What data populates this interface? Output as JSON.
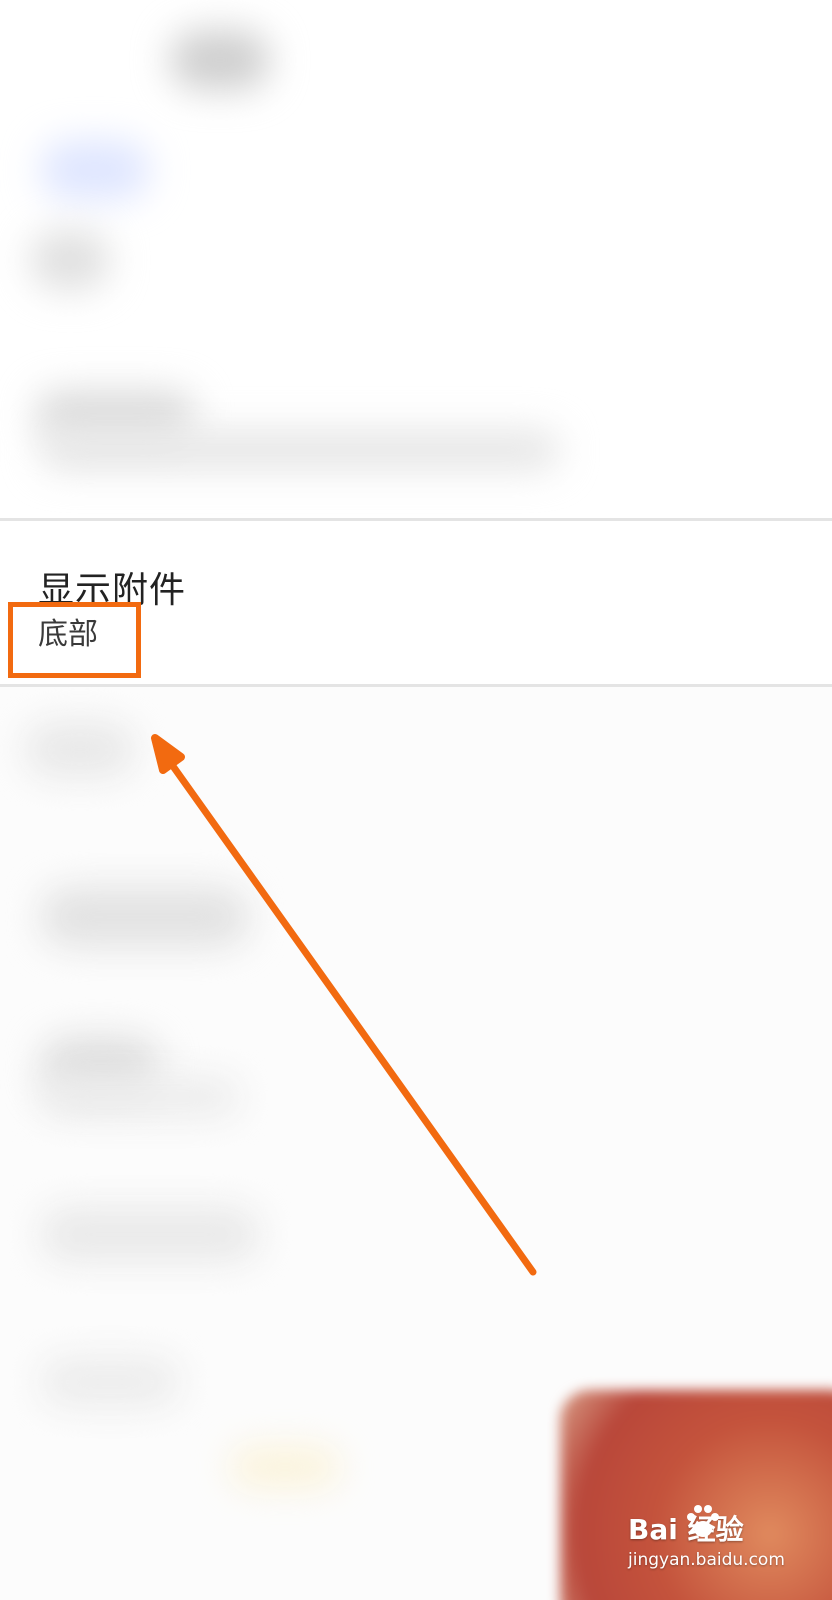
{
  "setting": {
    "title": "显示附件",
    "value": "底部"
  },
  "colors": {
    "accent": "#f26a10",
    "divider": "#e4e4e4",
    "title_text": "#222222",
    "value_text": "#3a3a3a"
  },
  "watermark": {
    "brand": "Bai  经验",
    "url": "jingyan.baidu.com",
    "icon": "paw-icon"
  },
  "annotations": {
    "highlight_target": "setting-value",
    "arrow_icon": "arrow-up-left-icon"
  }
}
